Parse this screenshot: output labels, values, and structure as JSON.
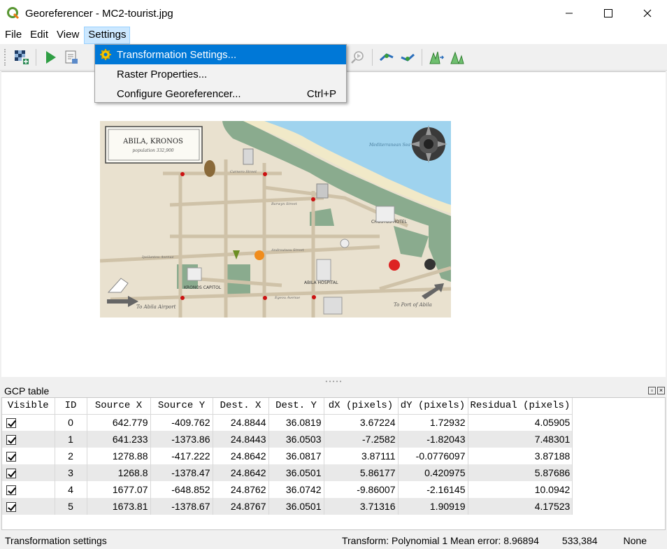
{
  "window": {
    "title": "Georeferencer - MC2-tourist.jpg",
    "controls": [
      "minimize-icon",
      "maximize-icon",
      "close-icon"
    ]
  },
  "menubar": {
    "items": [
      {
        "label": "File"
      },
      {
        "label": "Edit"
      },
      {
        "label": "View"
      },
      {
        "label": "Settings",
        "active": true
      }
    ]
  },
  "settings_menu": {
    "items": [
      {
        "label": "Transformation Settings...",
        "icon": "gear-icon",
        "highlighted": true,
        "shortcut": ""
      },
      {
        "label": "Raster Properties...",
        "shortcut": ""
      },
      {
        "label": "Configure Georeferencer...",
        "shortcut": "Ctrl+P"
      }
    ]
  },
  "toolbar": {
    "icons": [
      "open-raster-icon",
      "start-georeferencing-icon",
      "generate-script-icon",
      "zoom-last-icon",
      "zoom-next-icon",
      "link-georeferencer-icon",
      "link-qgis-icon",
      "full-histogram-stretch-icon",
      "local-histogram-stretch-icon"
    ]
  },
  "map": {
    "title": "ABILA, KRONOS",
    "population": "population 332,900",
    "sea_label": "Mediterranean Sea",
    "hotel_label": "CHOSTUS HOTEL",
    "capitol_label": "KRONOS CAPITOL",
    "hospital_label": "ABILA HOSPITAL",
    "airport_label": "To Abila Airport",
    "port_label": "To Port of Abila",
    "street_labels": [
      "Egeou Avenue",
      "Ipsilantou Avenue",
      "Androutsou Street",
      "Barwyn Street",
      "Carnero Street"
    ]
  },
  "colors": {
    "land": "#e9e1cf",
    "sea": "#9fd3ee",
    "park": "#8aab8e",
    "road": "#cfc2a8",
    "highlight": "#0078d7",
    "menu_active": "#cce8ff"
  },
  "gcp_table": {
    "title": "GCP table",
    "columns": [
      "Visible",
      "ID",
      "Source X",
      "Source Y",
      "Dest. X",
      "Dest. Y",
      "dX (pixels)",
      "dY (pixels)",
      "Residual (pixels)"
    ],
    "rows": [
      {
        "visible": true,
        "id": "0",
        "source_x": "642.779",
        "source_y": "-409.762",
        "dest_x": "24.8844",
        "dest_y": "36.0819",
        "dx": "3.67224",
        "dy": "1.72932",
        "residual": "4.05905"
      },
      {
        "visible": true,
        "id": "1",
        "source_x": "641.233",
        "source_y": "-1373.86",
        "dest_x": "24.8443",
        "dest_y": "36.0503",
        "dx": "-7.2582",
        "dy": "-1.82043",
        "residual": "7.48301"
      },
      {
        "visible": true,
        "id": "2",
        "source_x": "1278.88",
        "source_y": "-417.222",
        "dest_x": "24.8642",
        "dest_y": "36.0817",
        "dx": "3.87111",
        "dy": "-0.0776097",
        "residual": "3.87188"
      },
      {
        "visible": true,
        "id": "3",
        "source_x": "1268.8",
        "source_y": "-1378.47",
        "dest_x": "24.8642",
        "dest_y": "36.0501",
        "dx": "5.86177",
        "dy": "0.420975",
        "residual": "5.87686"
      },
      {
        "visible": true,
        "id": "4",
        "source_x": "1677.07",
        "source_y": "-648.852",
        "dest_x": "24.8762",
        "dest_y": "36.0742",
        "dx": "-9.86007",
        "dy": "-2.16145",
        "residual": "10.0942"
      },
      {
        "visible": true,
        "id": "5",
        "source_x": "1673.81",
        "source_y": "-1378.67",
        "dest_x": "24.8767",
        "dest_y": "36.0501",
        "dx": "3.71316",
        "dy": "1.90919",
        "residual": "4.17523"
      }
    ]
  },
  "statusbar": {
    "left": "Transformation settings",
    "transform": "Transform: Polynomial 1 Mean error: 8.96894",
    "coordinate": "533,384",
    "projection": "None"
  }
}
